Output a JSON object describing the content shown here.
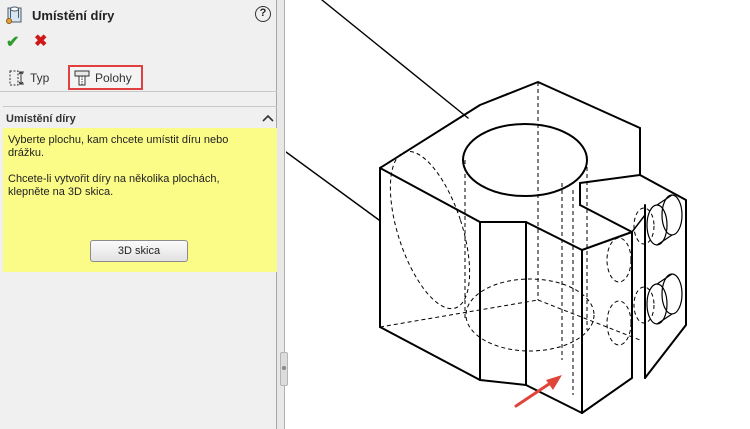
{
  "property_manager": {
    "title": "Umístění díry",
    "help_icon": "question-icon",
    "ok_icon": "checkmark-icon",
    "cancel_icon": "close-icon",
    "tabs": [
      {
        "label": "Typ",
        "icon": "hole-type-icon"
      },
      {
        "label": "Polohy",
        "icon": "hole-position-icon",
        "active": true,
        "highlight_color": "#e04040"
      }
    ],
    "section": {
      "title": "Umístění díry",
      "message_line1": "Vyberte plochu, kam chcete umístit díru nebo",
      "message_line2": "drážku.",
      "message_line3": "Chcete-li vytvořit díry na několika plochách,",
      "message_line4": "klepněte na 3D skica.",
      "button_label": "3D skica",
      "message_bg": "#fbfb88"
    }
  },
  "viewport": {
    "model": "isometric-block-with-holes",
    "annotation": "red-arrow"
  }
}
